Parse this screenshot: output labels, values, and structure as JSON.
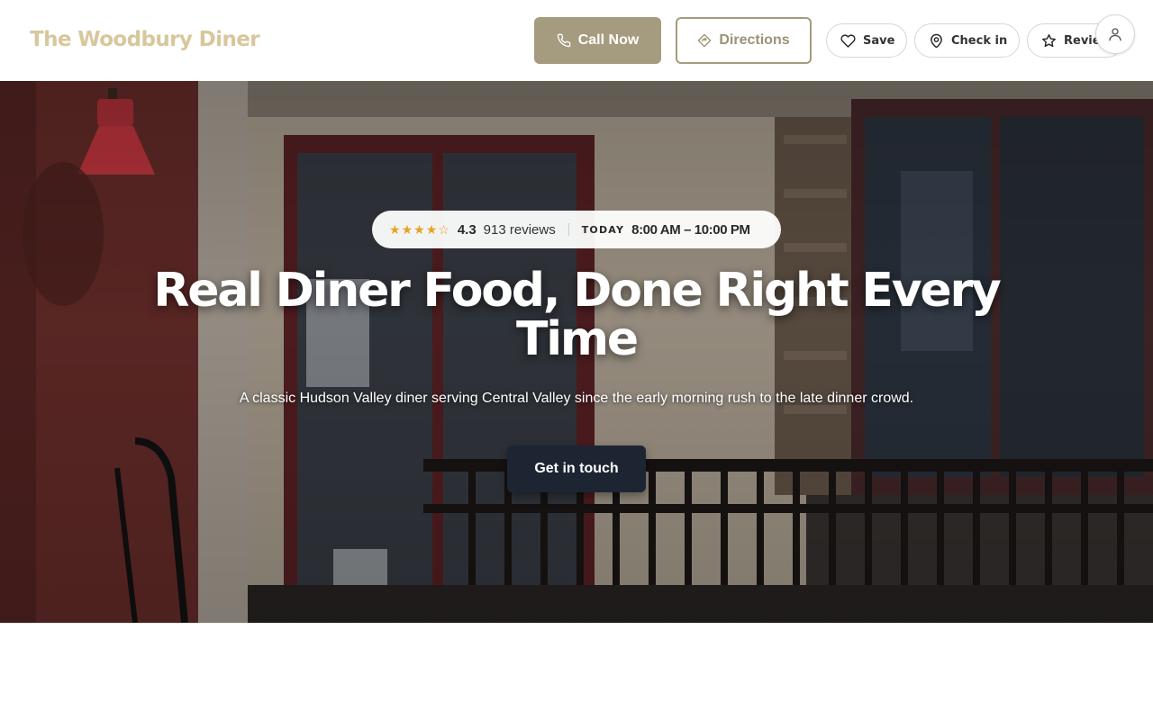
{
  "header": {
    "brand": "The Woodbury Diner",
    "call_label": "Call Now",
    "directions_label": "Directions",
    "save_label": "Save",
    "checkin_label": "Check in",
    "review_label": "Review"
  },
  "hero": {
    "rating_stars": 4.3,
    "rating_value": "4.3",
    "review_count": "913 reviews",
    "today_label": "TODAY",
    "hours": "8:00 AM – 10:00 PM",
    "headline": "Real Diner Food, Done Right Every Time",
    "subheadline": "A classic Hudson Valley diner serving Central Valley since the early morning rush to the late dinner crowd.",
    "cta_label": "Get in touch"
  },
  "icons": {
    "call": "phone-icon",
    "directions": "directions-icon",
    "save": "heart-icon",
    "checkin": "map-pin-icon",
    "review": "star-outline-icon",
    "account": "user-icon"
  },
  "colors": {
    "brand": "#d8c79c",
    "primary_button": "#a59b7e",
    "cta_button": "#1d2533",
    "star": "#e5a323"
  }
}
